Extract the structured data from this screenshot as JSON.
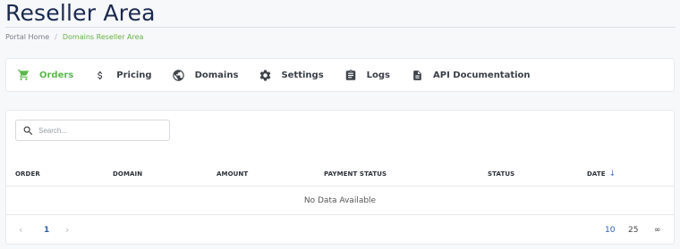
{
  "page": {
    "title": "Reseller Area"
  },
  "breadcrumb": {
    "home": "Portal Home",
    "separator": "/",
    "current": "Domains Reseller Area"
  },
  "nav": {
    "items": [
      {
        "label": "Orders",
        "icon": "cart-icon",
        "active": true
      },
      {
        "label": "Pricing",
        "icon": "dollar-icon",
        "active": false
      },
      {
        "label": "Domains",
        "icon": "globe-icon",
        "active": false
      },
      {
        "label": "Settings",
        "icon": "gear-icon",
        "active": false
      },
      {
        "label": "Logs",
        "icon": "clipboard-icon",
        "active": false
      },
      {
        "label": "API Documentation",
        "icon": "document-icon",
        "active": false
      }
    ]
  },
  "search": {
    "placeholder": "Search...",
    "value": ""
  },
  "table": {
    "columns": [
      "ORDER",
      "DOMAIN",
      "AMOUNT",
      "PAYMENT STATUS",
      "STATUS",
      "DATE"
    ],
    "sort_icon": "arrow-down-icon",
    "rows": [],
    "empty_text": "No Data Available"
  },
  "pagination": {
    "prev": "‹",
    "current_page": "1",
    "next": "›",
    "page_sizes": [
      "10",
      "25",
      "∞"
    ],
    "selected_size": "10"
  },
  "colors": {
    "accent": "#5ab84a",
    "link": "#2b5fa6",
    "title": "#1a2a4f"
  }
}
